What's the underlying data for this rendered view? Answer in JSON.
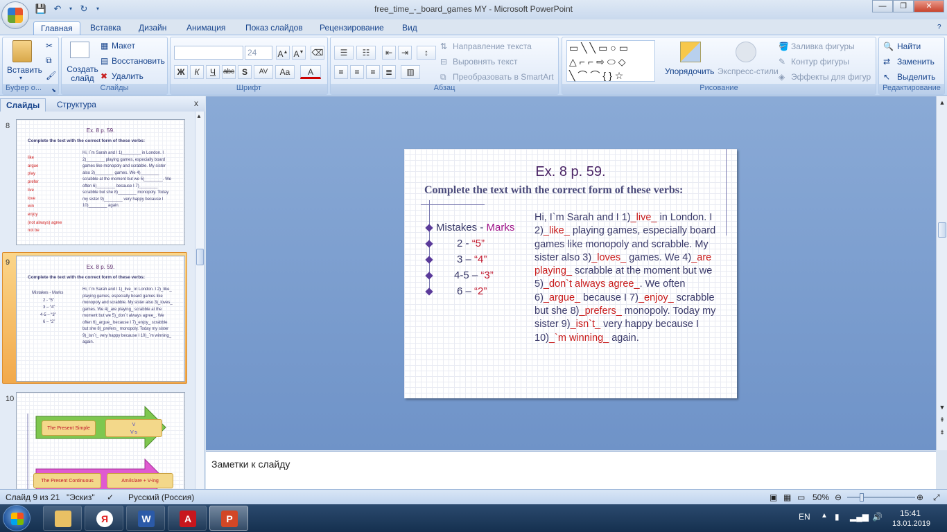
{
  "window": {
    "title": "free_time_-_board_games MY - Microsoft PowerPoint",
    "min": "—",
    "max": "❐",
    "close": "✕"
  },
  "ribbon_tabs": [
    "Главная",
    "Вставка",
    "Дизайн",
    "Анимация",
    "Показ слайдов",
    "Рецензирование",
    "Вид"
  ],
  "clipboard": {
    "paste": "Вставить",
    "group": "Буфер о..."
  },
  "slides_group": {
    "new_slide": "Создать слайд",
    "layout": "Макет",
    "reset": "Восстановить",
    "delete": "Удалить",
    "group": "Слайды"
  },
  "font_group": {
    "font_size": "24",
    "group": "Шрифт",
    "bold": "Ж",
    "italic": "К",
    "underline": "Ч",
    "strike": "abc",
    "shadow": "S",
    "spacing": "AV",
    "case": "Aa",
    "color": "A"
  },
  "paragraph_group": {
    "text_direction": "Направление текста",
    "align_text": "Выровнять текст",
    "smartart": "Преобразовать в SmartArt",
    "group": "Абзац"
  },
  "drawing_group": {
    "arrange": "Упорядочить",
    "express_styles": "Экспресс-стили",
    "fill": "Заливка фигуры",
    "outline": "Контур фигуры",
    "effects": "Эффекты для фигур",
    "group": "Рисование"
  },
  "editing_group": {
    "find": "Найти",
    "replace": "Заменить",
    "select": "Выделить",
    "group": "Редактирование"
  },
  "panel": {
    "tab_slides": "Слайды",
    "tab_outline": "Структура",
    "close": "x"
  },
  "thumbs": {
    "n8": "8",
    "n9": "9",
    "n10": "10",
    "t8_title": "Ex. 8 p. 59.",
    "t8_sub": "Complete the text with the correct form of these verbs:",
    "t8_verbs": [
      "like",
      "argue",
      "play",
      "prefer",
      "live",
      "love",
      "win",
      "enjoy",
      "(not always) agree",
      "not be"
    ],
    "t8_para": "Hi, I`m Sarah and I 1)________ in London. I 2)________ playing games, especially board games like monopoly and scrabble. My sister also 3)________ games. We 4)________ scrabble at the moment but we 5)________. We often 6)________ because I 7)________ scrabble but she 8)________ monopoly. Today my sister 9)________ very happy because I 10)________ again.",
    "t9_marks": [
      "Mistakes - Marks",
      "2 - “5”",
      "3 – “4”",
      "4-5 – “3”",
      "6 – “2”"
    ],
    "t9_para": "Hi, I`m Sarah and I 1)_live_ in London. I 2)_like_ playing games, especially board games like monopoly and scrabble. My sister also 3)_loves_ games. We 4)_are playing_ scrabble at the moment but we 5)_don`t always agree_. We often 6)_argue_ because I 7)_enjoy_ scrabble but she 8)_prefers_ monopoly. Today my sister 9)_isn`t_ very happy because I 10)_`m winning_ again.",
    "t10_box1": "The Present Simple",
    "t10_box2": "V",
    "t10_box2b": "V-s",
    "t10_box3": "The Present Continuous",
    "t10_box4": "Am/is/are + V-ing"
  },
  "slide": {
    "title": "Ex. 8 p. 59.",
    "subtitle": "Complete the text with the correct form of these verbs:",
    "marks_head_a": "Mistakes - ",
    "marks_head_b": "Marks",
    "marks": [
      {
        "m": "2 - ",
        "g": "“5”"
      },
      {
        "m": "3 – ",
        "g": "“4”"
      },
      {
        "m": "4-5 – ",
        "g": "“3”"
      },
      {
        "m": "6 – ",
        "g": "“2”"
      }
    ],
    "p": {
      "s1": "Hi, I`m Sarah and I 1)",
      "a1": "_live_",
      "s2": " in London. I 2)",
      "a2": "_like_",
      "s3": " playing games, especially board games like monopoly and scrabble. My sister also 3)",
      "a3": "_loves_",
      "s4": " games. We 4)",
      "a4": "_are playing_",
      "s5": " scrabble at the moment but we 5)",
      "a5": "_don`t always agree_",
      "s6": ". We often 6)",
      "a6": "_argue_",
      "s7": " because I 7)",
      "a7": "_enjoy_",
      "s8": " scrabble but she 8)",
      "a8": "_prefers_",
      "s9": " monopoly. Today my sister 9)",
      "a9": "_isn`t_",
      "s10": " very happy because I 10)",
      "a10": "_`m winning_",
      "s11": " again."
    }
  },
  "notes_placeholder": "Заметки к слайду",
  "status": {
    "slide": "Слайд 9 из 21",
    "theme": "\"Эскиз\"",
    "lang": "Русский (Россия)",
    "zoom": "50%"
  },
  "tray": {
    "lang": "EN",
    "time": "15:41",
    "date": "13.01.2019"
  }
}
